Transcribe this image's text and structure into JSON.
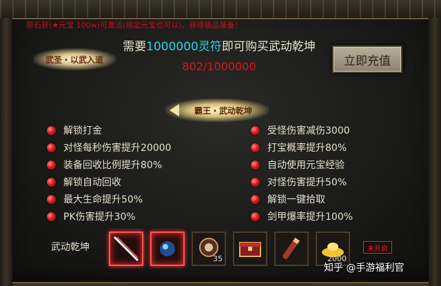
{
  "header": {
    "note": "原石获(★元宝 100w)可激活(绑定元宝也可以)，获得极品装备！"
  },
  "title_badge": "武圣・以武入道",
  "purchase": {
    "prefix": "需要",
    "amount": "1000000灵符",
    "suffix": "即可购买武动乾坤",
    "progress": "802/1000000",
    "button_label": "立即充值"
  },
  "tier_badge": "霸王・武动乾坤",
  "benefits_left": [
    "解锁打金",
    "对怪每秒伤害提升20000",
    "装备回收比例提升80%",
    "解锁自动回收",
    "最大生命提升50%",
    "PK伤害提升30%"
  ],
  "benefits_right": [
    "受怪伤害减伤3000",
    "打宝概率提升80%",
    "自动使用元宝经验",
    "对怪伤害提升50%",
    "解锁一键拾取",
    "剑甲爆率提升100%"
  ],
  "items": {
    "label": "武动乾坤",
    "slots": [
      {
        "icon": "sword-icon",
        "count": ""
      },
      {
        "icon": "orb-icon",
        "count": ""
      },
      {
        "icon": "medal-icon",
        "count": "35"
      },
      {
        "icon": "treasure-chest-icon",
        "count": ""
      },
      {
        "icon": "scroll-icon",
        "count": ""
      },
      {
        "icon": "gold-ingot-icon",
        "count": "2000"
      }
    ],
    "locked_tag": "未开启"
  },
  "watermark": "知乎 @手游福利官",
  "colors": {
    "accent_cyan": "#2ad4e8",
    "accent_red": "#e01216",
    "text": "#e6e0d0"
  }
}
